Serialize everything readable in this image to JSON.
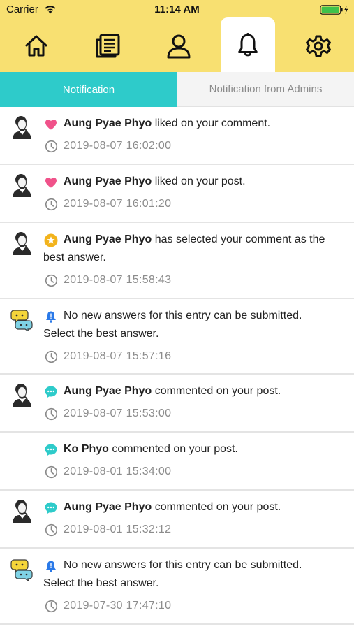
{
  "status": {
    "carrier": "Carrier",
    "time": "11:14 AM"
  },
  "tabs": [
    {
      "icon": "home-icon",
      "active": false
    },
    {
      "icon": "newspaper-icon",
      "active": false
    },
    {
      "icon": "user-icon",
      "active": false
    },
    {
      "icon": "bell-icon",
      "active": true
    },
    {
      "icon": "gear-icon",
      "active": false
    }
  ],
  "segments": {
    "active": "Notification",
    "inactive": "Notification from Admins"
  },
  "notifications": [
    {
      "avatar": "man-avatar",
      "kind": "heart-icon",
      "name": "Aung Pyae Phyo",
      "text": " liked on your comment.",
      "time": "2019-08-07 16:02:00"
    },
    {
      "avatar": "man-avatar",
      "kind": "heart-icon",
      "name": "Aung Pyae Phyo",
      "text": " liked on your post.",
      "time": "2019-08-07 16:01:20"
    },
    {
      "avatar": "man-avatar",
      "kind": "star-icon",
      "name": "Aung Pyae Phyo",
      "text": " has selected your comment as the best answer.",
      "time": "2019-08-07 15:58:43"
    },
    {
      "avatar": "chat-bubbles-avatar",
      "kind": "bell-icon",
      "name": "",
      "text": "No new answers for this entry can be submitted. Select the best answer.",
      "time": "2019-08-07 15:57:16"
    },
    {
      "avatar": "man-avatar",
      "kind": "comment-icon",
      "name": "Aung Pyae Phyo",
      "text": " commented on your post.",
      "time": "2019-08-07 15:53:00"
    },
    {
      "avatar": "",
      "kind": "comment-icon",
      "name": "Ko Phyo",
      "text": " commented on your post.",
      "time": "2019-08-01 15:34:00"
    },
    {
      "avatar": "man-avatar",
      "kind": "comment-icon",
      "name": "Aung Pyae Phyo",
      "text": " commented on your post.",
      "time": "2019-08-01 15:32:12"
    },
    {
      "avatar": "chat-bubbles-avatar",
      "kind": "bell-icon",
      "name": "",
      "text": "No new answers for this entry can be submitted. Select the best answer.",
      "time": "2019-07-30 17:47:10"
    }
  ],
  "colors": {
    "header": "#f8e071",
    "accent": "#2ecbca",
    "heart": "#f0528a",
    "star": "#f2b31c",
    "info": "#2a79e8",
    "muted": "#8c8c8c"
  }
}
